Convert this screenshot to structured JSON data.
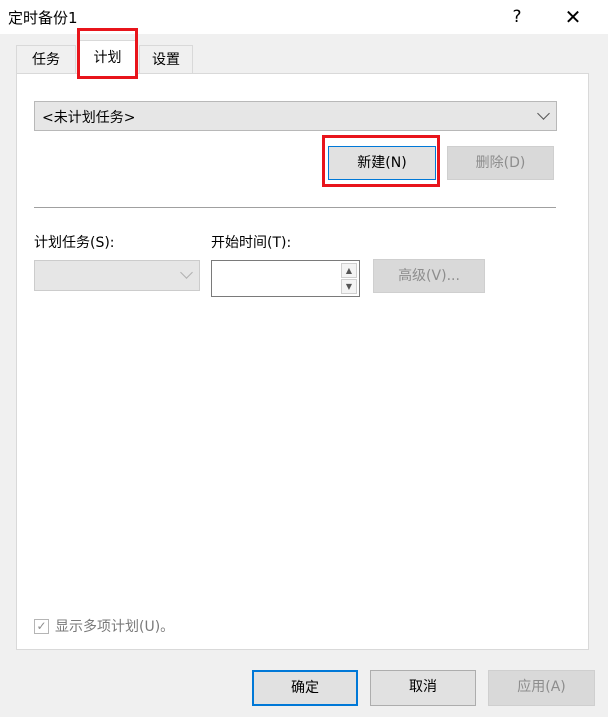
{
  "window": {
    "title": "定时备份1",
    "help_label": "?",
    "close_label": "✕"
  },
  "tabs": [
    {
      "label": "任务"
    },
    {
      "label": "计划"
    },
    {
      "label": "设置"
    }
  ],
  "plan": {
    "task_dropdown_value": "<未计划任务>",
    "new_button": "新建(N)",
    "delete_button": "删除(D)",
    "schedule_label": "计划任务(S):",
    "start_time_label": "开始时间(T):",
    "advanced_button": "高级(V)...",
    "multi_schedule_label": "显示多项计划(U)。"
  },
  "footer": {
    "ok_button": "确定",
    "cancel_button": "取消",
    "apply_button": "应用(A)"
  },
  "colors": {
    "highlight": "#e8141b",
    "focus_border": "#0078d7"
  }
}
